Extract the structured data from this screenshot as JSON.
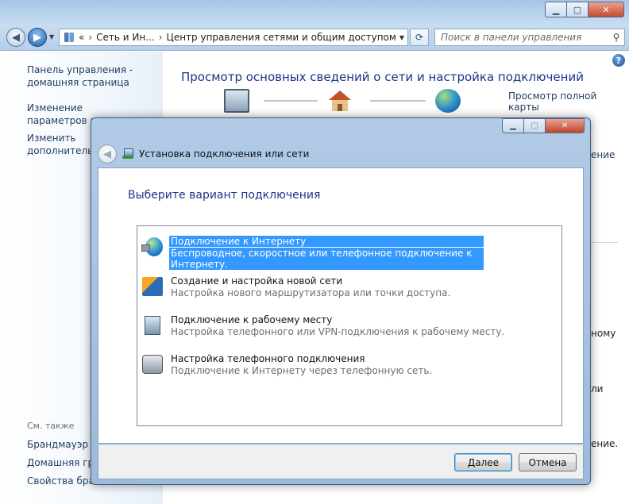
{
  "main_window": {
    "address": {
      "prefix": "«",
      "crumb1": "Сеть и Ин...",
      "crumb2": "Центр управления сетями и общим доступом"
    },
    "search_placeholder": "Поиск в панели управления",
    "sidebar": {
      "home": "Панель управления - домашняя страница",
      "adapter": "Изменение параметров адаптера",
      "sharing": "Изменить дополнительные параметры общего доступа",
      "see_also": "См. также",
      "see_also_links": [
        "Брандмауэр Windows",
        "Домашняя группа",
        "Свойства браузера"
      ]
    },
    "heading": "Просмотр основных сведений о сети и настройка подключений",
    "full_map": "Просмотр полной карты",
    "peek_text": [
      "ение",
      "ному",
      "ли",
      "ение."
    ]
  },
  "dialog": {
    "title": "Установка подключения или сети",
    "heading": "Выберите вариант подключения",
    "options": [
      {
        "title": "Подключение к Интернету",
        "desc": "Беспроводное, скоростное или телефонное подключение к Интернету.",
        "icon": "internet-globe-icon",
        "selected": true
      },
      {
        "title": "Создание и настройка новой сети",
        "desc": "Настройка нового маршрутизатора или точки доступа.",
        "icon": "new-network-icon",
        "selected": false
      },
      {
        "title": "Подключение к рабочему месту",
        "desc": "Настройка телефонного или VPN-подключения к рабочему месту.",
        "icon": "workplace-icon",
        "selected": false
      },
      {
        "title": "Настройка телефонного подключения",
        "desc": "Подключение к Интернету через телефонную сеть.",
        "icon": "dialup-phone-icon",
        "selected": false
      }
    ],
    "next_label": "Далее",
    "cancel_label": "Отмена"
  },
  "colors": {
    "selection": "#3399ff",
    "heading_blue": "#1e3287",
    "link_blue": "#1e3c5e"
  }
}
